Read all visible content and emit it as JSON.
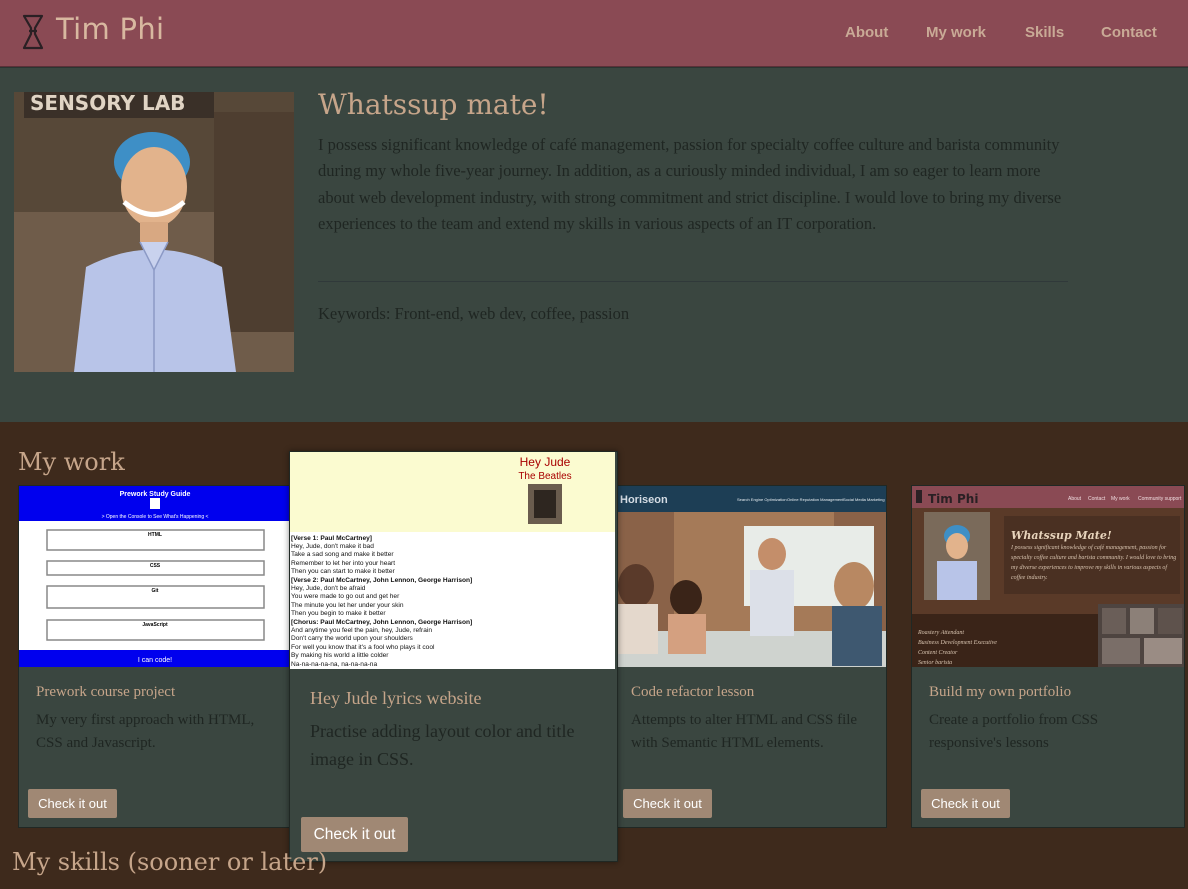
{
  "header": {
    "brand": "Tim Phi",
    "brand_icon": "coffee-chemex-icon",
    "nav": [
      {
        "label": "About"
      },
      {
        "label": "My work"
      },
      {
        "label": "Skills"
      },
      {
        "label": "Contact"
      }
    ]
  },
  "about": {
    "title": "Whatssup mate!",
    "bio": "I possess significant knowledge of café management, passion for specialty coffee culture and barista community during my whole five-year journey. In addition, as a curiously minded individual, I am so eager to learn more about web development industry, with strong commitment and strict discipline. I would love to bring my diverse experiences to the team and extend my skills in various aspects of an IT corporation.",
    "keywords": "Keywords: Front-end, web dev, coffee, passion",
    "photo_sign": "SENSORY LAB"
  },
  "work": {
    "title": "My work",
    "projects": [
      {
        "title": "Prework course project",
        "description": "My very first approach with HTML, CSS and Javascript.",
        "button": "Check it out",
        "thumb": {
          "heading": "Prework Study Guide",
          "subheading": "> Open the Console to See What's Happening <",
          "sections": [
            "HTML",
            "CSS",
            "Git",
            "JavaScript"
          ],
          "footer": "I can code!"
        }
      },
      {
        "title": "Hey Jude lyrics website",
        "description": "Practise adding layout color and title image in CSS.",
        "button": "Check it out",
        "thumb": {
          "song": "Hey Jude",
          "artist": "The Beatles",
          "lyrics": [
            "[Verse 1: Paul McCartney]",
            "Hey, Jude, don't make it bad",
            "Take a sad song and make it better",
            "Remember to let her into your heart",
            "Then you can start to make it better",
            "[Verse 2: Paul McCartney, John Lennon, George Harrison]",
            "Hey, Jude, don't be afraid",
            "You were made to go out and get her",
            "The minute you let her under your skin",
            "Then you begin to make it better",
            "[Chorus: Paul McCartney, John Lennon, George Harrison]",
            "And anytime you feel the pain, hey, Jude, refrain",
            "Don't carry the world upon your shoulders",
            "For well you know that it's a fool who plays it cool",
            "By making his world a little colder",
            "Na-na-na-na-na, na-na-na-na"
          ]
        }
      },
      {
        "title": "Code refactor lesson",
        "description": "Attempts to alter HTML and CSS file with Semantic HTML elements.",
        "button": "Check it out",
        "thumb": {
          "brand": "Horiseon",
          "nav": [
            "Search Engine Optimization",
            "Online Reputation Management",
            "Social Media Marketing"
          ]
        }
      },
      {
        "title": "Build my own portfolio",
        "description": "Create a portfolio from CSS responsive's lessons",
        "button": "Check it out",
        "thumb": {
          "brand": "Tim Phi",
          "nav": [
            "About",
            "Contact",
            "My work",
            "Community support"
          ],
          "heading": "Whatssup Mate!",
          "text": "I possess significant knowledge of café management, passion for specialty coffee culture and barista community. I would love to bring my diverse experiences to improve my skills in various aspects of coffee industry.",
          "list": [
            "Roastery Attendant",
            "Business Development Executive",
            "Content Creator",
            "Senior barista"
          ]
        }
      }
    ]
  },
  "skills": {
    "title": "My skills (sooner or later)"
  },
  "colors": {
    "nav_bg": "#8a4a54",
    "accent_text": "#c6a58a",
    "panel_bg": "#3a4640",
    "page_bg": "#3e2a1c",
    "button_bg": "#a08874"
  }
}
